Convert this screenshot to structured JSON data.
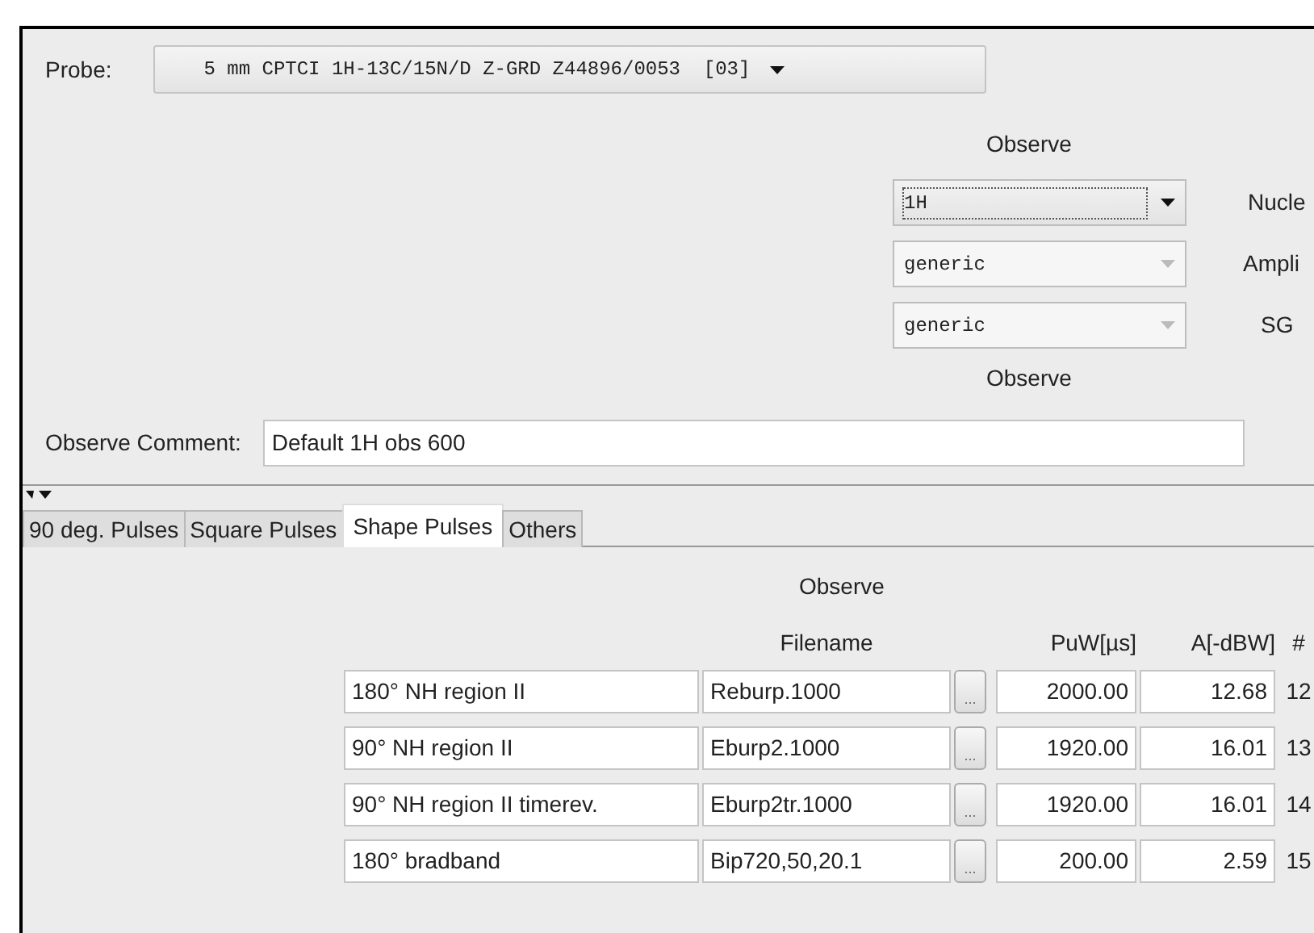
{
  "probe": {
    "label": "Probe:",
    "value": "5 mm CPTCI 1H-13C/15N/D Z-GRD Z44896/0053  [03]"
  },
  "observe_header": "Observe",
  "channel_settings": [
    {
      "value": "1H",
      "disabled": false,
      "label": "Nucle"
    },
    {
      "value": "generic",
      "disabled": true,
      "label": "Ampli"
    },
    {
      "value": "generic",
      "disabled": true,
      "label": "SG"
    }
  ],
  "observe_footer": "Observe",
  "comment": {
    "label": "Observe Comment:",
    "value": "Default 1H obs 600"
  },
  "tabs": [
    {
      "label": "90 deg. Pulses",
      "selected": false
    },
    {
      "label": "Square Pulses",
      "selected": false
    },
    {
      "label": "Shape Pulses",
      "selected": true
    },
    {
      "label": "Others",
      "selected": false
    }
  ],
  "table": {
    "group": "Observe",
    "columns": [
      "Filename",
      "PuW[µs]",
      "A[-dBW]",
      "#"
    ],
    "rows": [
      {
        "name": "180° NH region II",
        "filename": "Reburp.1000",
        "button": "...",
        "puw": "2000.00",
        "a": "12.68",
        "num": "12"
      },
      {
        "name": "90° NH region II",
        "filename": "Eburp2.1000",
        "button": "...",
        "puw": "1920.00",
        "a": "16.01",
        "num": "13"
      },
      {
        "name": "90° NH region II timerev.",
        "filename": "Eburp2tr.1000",
        "button": "...",
        "puw": "1920.00",
        "a": "16.01",
        "num": "14"
      },
      {
        "name": "180° bradband",
        "filename": "Bip720,50,20.1",
        "button": "...",
        "puw": "200.00",
        "a": "2.59",
        "num": "15"
      }
    ]
  }
}
